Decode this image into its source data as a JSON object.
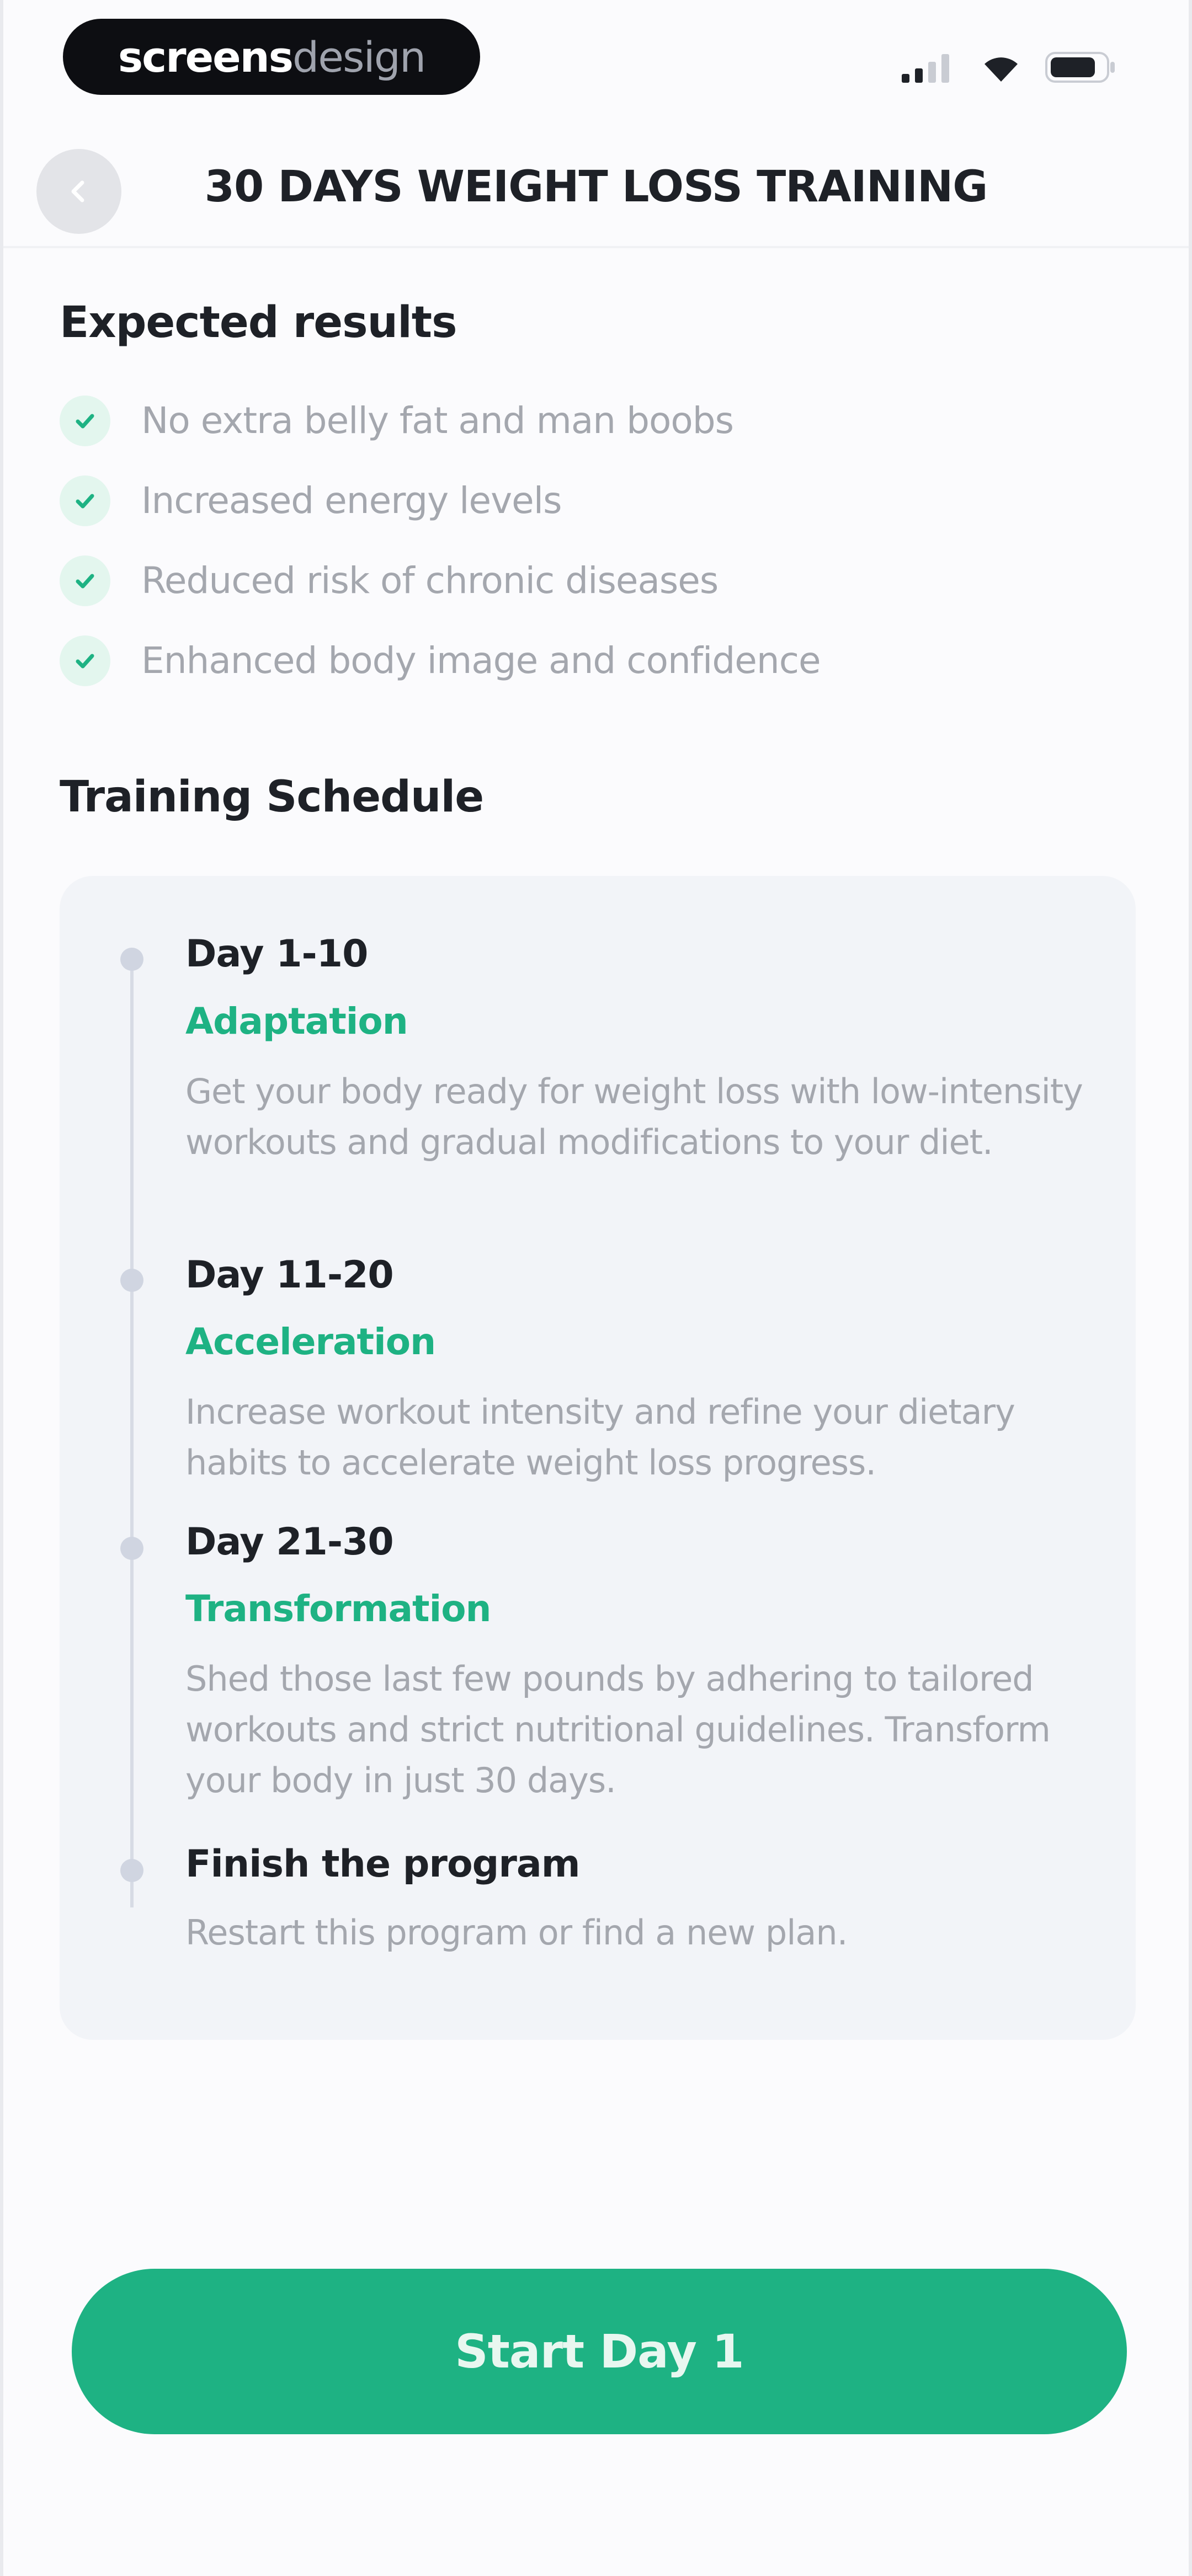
{
  "status_bar": {
    "brand_strong": "screens",
    "brand_light": "design"
  },
  "header": {
    "title": "30 DAYS WEIGHT LOSS TRAINING",
    "back_icon": "chevron-left-icon"
  },
  "expected_results": {
    "title": "Expected results",
    "items": [
      "No extra belly fat and man boobs",
      "Increased energy levels",
      "Reduced risk of chronic diseases",
      "Enhanced body image and confidence"
    ]
  },
  "training_schedule": {
    "title": "Training Schedule",
    "phases": [
      {
        "day": "Day 1-10",
        "name": "Adaptation",
        "description": "Get your body ready for weight loss with low-intensity workouts and gradual modifications to your diet."
      },
      {
        "day": "Day 11-20",
        "name": "Acceleration",
        "description": "Increase workout intensity and refine your dietary habits to accelerate weight loss progress."
      },
      {
        "day": "Day 21-30",
        "name": "Transformation",
        "description": "Shed those last few pounds by adhering to tailored workouts and strict nutritional guidelines. Transform your body in just 30 days."
      },
      {
        "day": "Finish the program",
        "name": "",
        "description": "Restart this program or find a new plan."
      }
    ]
  },
  "cta": {
    "label": "Start Day 1"
  },
  "colors": {
    "accent": "#1eb283",
    "check_bg": "#e3f6ee",
    "card_bg": "#f2f4f8",
    "muted_text": "#a4a7ae"
  }
}
